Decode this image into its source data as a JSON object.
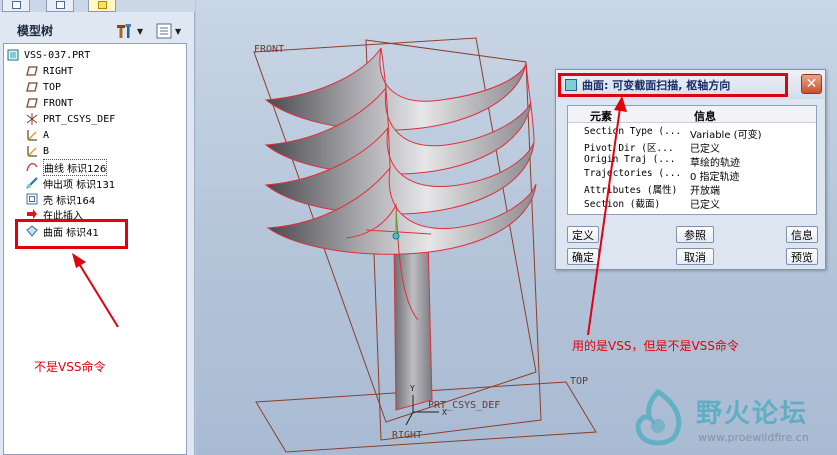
{
  "model_tree": {
    "title": "模型树",
    "root": "VSS-037.PRT",
    "items": [
      {
        "label": "RIGHT",
        "icon": "datum-plane-icon"
      },
      {
        "label": "TOP",
        "icon": "datum-plane-icon"
      },
      {
        "label": "FRONT",
        "icon": "datum-plane-icon"
      },
      {
        "label": "PRT_CSYS_DEF",
        "icon": "csys-icon"
      },
      {
        "label": "A",
        "icon": "datum-curve-icon"
      },
      {
        "label": "B",
        "icon": "datum-curve-icon"
      },
      {
        "label": "曲线 标识126",
        "icon": "curve-feature-icon"
      },
      {
        "label": "伸出项 标识131",
        "icon": "protrusion-icon"
      },
      {
        "label": "壳 标识164",
        "icon": "shell-icon"
      },
      {
        "label": "在此插入",
        "icon": "insert-here-icon"
      },
      {
        "label": "曲面 标识41",
        "icon": "surface-icon"
      }
    ]
  },
  "viewport": {
    "datum_labels": {
      "front": "FRONT",
      "top": "TOP",
      "right": "RIGHT",
      "csys": "PRT_CSYS_DEF",
      "axis_x": "X",
      "axis_y": "Y"
    }
  },
  "dialog": {
    "title": "曲面: 可变截面扫描, 枢轴方向",
    "close_label": "✕",
    "columns": {
      "element": "元素",
      "info": "信息"
    },
    "rows": [
      {
        "element": "Section Type (...",
        "info": "Variable (可变)"
      },
      {
        "element": "Pivot Dir (区...",
        "info": "已定义"
      },
      {
        "element": "Origin Traj (...",
        "info": "草绘的轨迹"
      },
      {
        "element": "Trajectories (...",
        "info": "0 指定轨迹"
      },
      {
        "element": "Attributes (属性)",
        "info": "开放端"
      },
      {
        "element": "Section (截面)",
        "info": "已定义"
      }
    ],
    "buttons": {
      "define": "定义",
      "reference": "参照",
      "info": "信息",
      "ok": "确定",
      "cancel": "取消",
      "preview": "预览"
    }
  },
  "annotations": {
    "left_note": "不是VSS命令",
    "right_note": "用的是VSS，但是不是VSS命令"
  },
  "watermark": {
    "title": "野火论坛",
    "url": "www.proewildfire.cn"
  },
  "colors": {
    "annotation_red": "#e1000d",
    "datum_plane": "#8a3f2a",
    "surface_edge": "#e0303a"
  }
}
